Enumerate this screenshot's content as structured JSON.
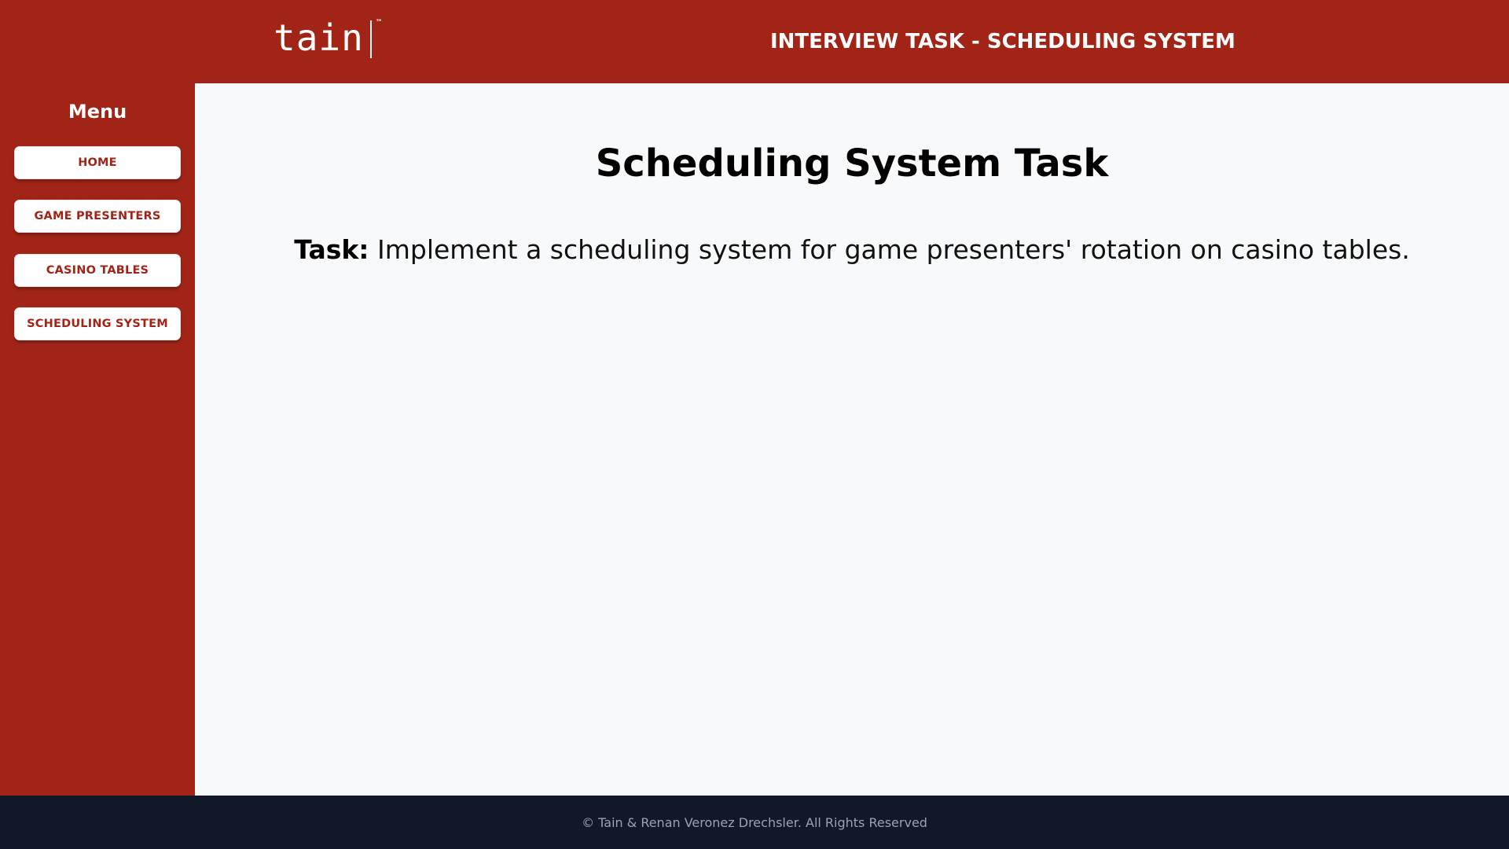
{
  "header": {
    "logo_text": "tain",
    "logo_tm": "™",
    "title": "INTERVIEW TASK - SCHEDULING SYSTEM"
  },
  "sidebar": {
    "menu_title": "Menu",
    "items": [
      {
        "label": "HOME"
      },
      {
        "label": "GAME PRESENTERS"
      },
      {
        "label": "CASINO TABLES"
      },
      {
        "label": "SCHEDULING SYSTEM"
      }
    ]
  },
  "main": {
    "title": "Scheduling System Task",
    "task_label": "Task:",
    "task_text": "Implement a scheduling system for game presenters' rotation on casino tables."
  },
  "footer": {
    "text": "© Tain & Renan Veronez Drechsler. All Rights Reserved"
  },
  "colors": {
    "brand_red": "#a12417",
    "content_bg": "#f8f9fa",
    "footer_bg": "#111827",
    "footer_text": "#9ca3af"
  }
}
